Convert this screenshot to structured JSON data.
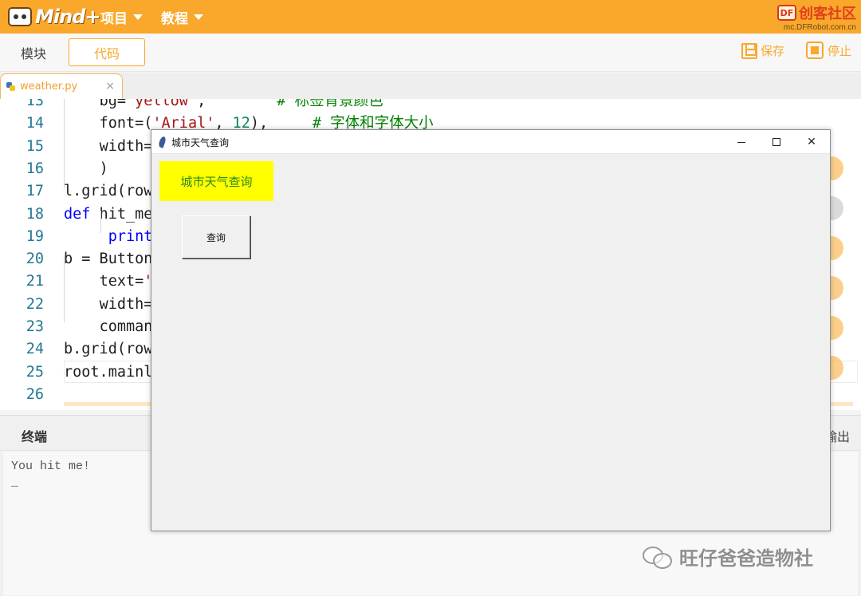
{
  "app": {
    "logo_text": "Mind+",
    "menus": [
      {
        "label": "项目"
      },
      {
        "label": "教程"
      }
    ],
    "brand": {
      "name": "创客社区",
      "badge": "DF",
      "url": "mc.DFRobot.com.cn"
    }
  },
  "toolbar": {
    "blocks_label": "模块",
    "code_label": "代码",
    "save_label": "保存",
    "stop_label": "停止"
  },
  "file_tab": {
    "name": "weather.py",
    "close": "×"
  },
  "editor": {
    "lines": [
      {
        "n": "13",
        "indent": "    ",
        "segments": [
          [
            "",
            "bg="
          ],
          [
            "str",
            "'yellow'"
          ],
          [
            "",
            ",        "
          ],
          [
            "cm",
            "# 标签背景颜色"
          ]
        ]
      },
      {
        "n": "14",
        "indent": "    ",
        "segments": [
          [
            "",
            "font=("
          ],
          [
            "str",
            "'Arial'"
          ],
          [
            "",
            ", "
          ],
          [
            "num",
            "12"
          ],
          [
            "",
            "),     "
          ],
          [
            "cm",
            "# 字体和字体大小"
          ]
        ]
      },
      {
        "n": "15",
        "indent": "    ",
        "segments": [
          [
            "",
            "width="
          ]
        ]
      },
      {
        "n": "16",
        "indent": "    ",
        "segments": [
          [
            "",
            ")"
          ]
        ]
      },
      {
        "n": "17",
        "indent": "",
        "segments": [
          [
            "",
            "l.grid(row"
          ]
        ]
      },
      {
        "n": "18",
        "indent": "",
        "segments": [
          [
            "kw",
            "def"
          ],
          [
            "",
            " hit_me"
          ]
        ]
      },
      {
        "n": "19",
        "indent": "     ",
        "segments": [
          [
            "fn",
            "print"
          ]
        ]
      },
      {
        "n": "20",
        "indent": "",
        "segments": [
          [
            "",
            "b = Button"
          ]
        ]
      },
      {
        "n": "21",
        "indent": "    ",
        "segments": [
          [
            "",
            "text="
          ],
          [
            "str",
            "'"
          ]
        ]
      },
      {
        "n": "22",
        "indent": "    ",
        "segments": [
          [
            "",
            "width="
          ]
        ]
      },
      {
        "n": "23",
        "indent": "    ",
        "segments": [
          [
            "",
            "comman"
          ]
        ]
      },
      {
        "n": "24",
        "indent": "",
        "segments": [
          [
            "",
            "b.grid(row"
          ]
        ]
      },
      {
        "n": "25",
        "indent": "",
        "segments": [
          [
            "",
            "root.mainl"
          ]
        ]
      },
      {
        "n": "26",
        "indent": "",
        "segments": []
      }
    ]
  },
  "terminal": {
    "title": "终端",
    "output_label": "输出",
    "lines": [
      "You hit me!",
      "_"
    ]
  },
  "tk_window": {
    "title": "城市天气查询",
    "close_symbol": "✕",
    "label_text": "城市天气查询",
    "button_text": "查询"
  },
  "watermark": {
    "text": "旺仔爸爸造物社"
  },
  "colors": {
    "accent": "#f9a82b",
    "label_bg": "#ffff00",
    "label_fg": "#2e8b1e"
  }
}
